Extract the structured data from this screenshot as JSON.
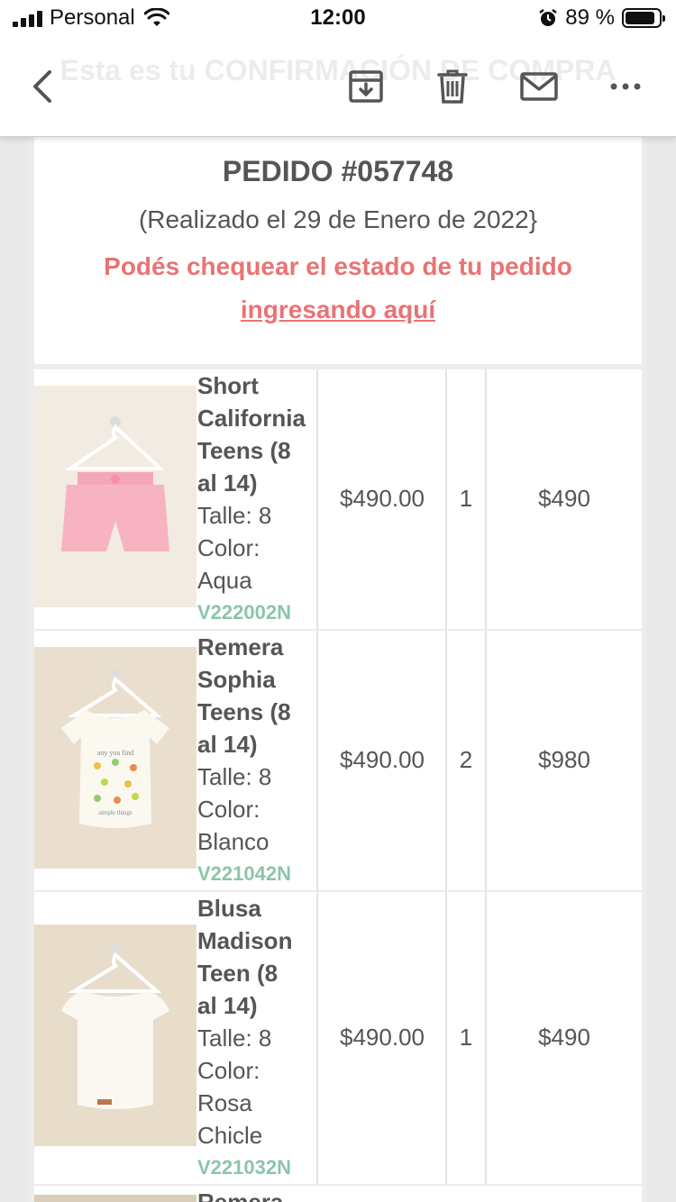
{
  "status_bar": {
    "carrier": "Personal",
    "time": "12:00",
    "battery": "89 %",
    "battery_level": 0.89
  },
  "toolbar": {
    "ghost_title": "Esta es tu CONFIRMACIÓN DE COMPRA"
  },
  "order": {
    "number": "PEDIDO #057748",
    "date": "(Realizado el 29 de Enero de 2022}",
    "check_text": "Podés chequear el estado de tu pedido",
    "check_link": "ingresando aquí"
  },
  "items": [
    {
      "name_lines": [
        "Short",
        "California",
        "Teens (8",
        "al 14)"
      ],
      "size": "Talle: 8",
      "color_lines": [
        "Color:",
        "Aqua"
      ],
      "sku": "V222002N",
      "price": "$490.00",
      "qty": "1",
      "total": "$490",
      "image": "pink-shorts-on-hanger"
    },
    {
      "name_lines": [
        "Remera",
        "Sophia",
        "Teens (8",
        "al 14)"
      ],
      "size": "Talle: 8",
      "color_lines": [
        "Color:",
        "Blanco"
      ],
      "sku": "V221042N",
      "price": "$490.00",
      "qty": "2",
      "total": "$980",
      "image": "white-tshirt-on-hanger"
    },
    {
      "name_lines": [
        "Blusa",
        "Madison",
        "Teen (8",
        "al 14)"
      ],
      "size": "Talle: 8",
      "color_lines": [
        "Color:",
        "Rosa",
        "Chicle"
      ],
      "sku": "V221032N",
      "price": "$490.00",
      "qty": "1",
      "total": "$490",
      "image": "white-blouse-on-hanger"
    }
  ],
  "next_item_partial": "Remera"
}
